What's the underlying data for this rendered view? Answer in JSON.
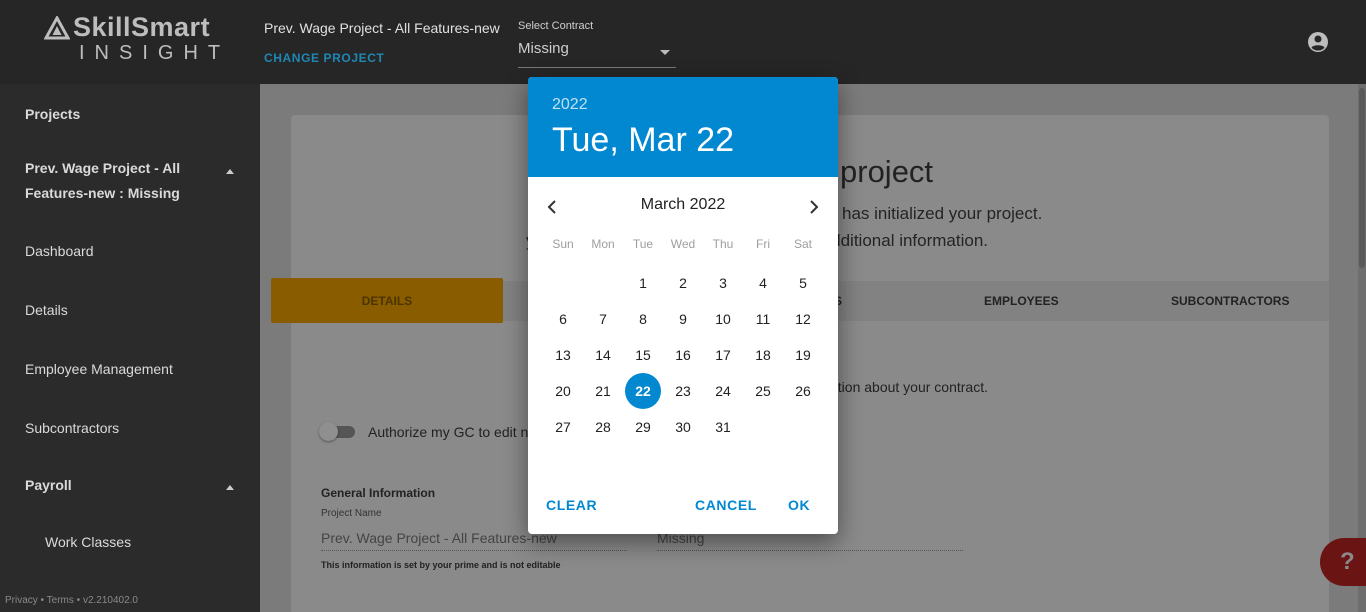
{
  "topbar": {
    "logo_main": "SkillSmart",
    "logo_sub": "INSIGHT",
    "project_name": "Prev. Wage Project - All Features-new",
    "change_project": "CHANGE PROJECT",
    "contract_label": "Select Contract",
    "contract_value": "Missing",
    "account_icon": "account-circle-icon"
  },
  "sidebar": {
    "projects": "Projects",
    "project_line1": "Prev. Wage Project - All",
    "project_line2": "Features-new : Missing",
    "dashboard": "Dashboard",
    "details": "Details",
    "employee_management": "Employee Management",
    "subcontractors": "Subcontractors",
    "payroll": "Payroll",
    "work_classes": "Work Classes",
    "footer": "Privacy • Terms • v2.210402.0"
  },
  "main": {
    "heading_partial": "project",
    "line1_partial": "has initialized your project.",
    "line2_partial": "y                                             out some additional information.",
    "tabs": {
      "details": "DETAILS",
      "hidden_partial": "S",
      "employees": "EMPLOYEES",
      "subcontractors": "SUBCONTRACTORS"
    },
    "info_partial": "ation about your contract.",
    "toggle_label": "Authorize my GC to edit n",
    "general_info": "General Information",
    "project_name_label": "Project Name",
    "project_name_value": "Prev. Wage Project - All Features-new",
    "contract_value": "Missing",
    "note": "This information is set by your prime and is not editable",
    "help": "?"
  },
  "picker": {
    "year": "2022",
    "date": "Tue, Mar 22",
    "month": "March 2022",
    "weekdays": [
      "Sun",
      "Mon",
      "Tue",
      "Wed",
      "Thu",
      "Fri",
      "Sat"
    ],
    "weeks": [
      [
        "",
        "",
        "1",
        "2",
        "3",
        "4",
        "5"
      ],
      [
        "6",
        "7",
        "8",
        "9",
        "10",
        "11",
        "12"
      ],
      [
        "13",
        "14",
        "15",
        "16",
        "17",
        "18",
        "19"
      ],
      [
        "20",
        "21",
        "22",
        "23",
        "24",
        "25",
        "26"
      ],
      [
        "27",
        "28",
        "29",
        "30",
        "31",
        "",
        ""
      ]
    ],
    "selected_day": "22",
    "clear": "CLEAR",
    "cancel": "CANCEL",
    "ok": "OK",
    "accent": "#0288d1"
  }
}
